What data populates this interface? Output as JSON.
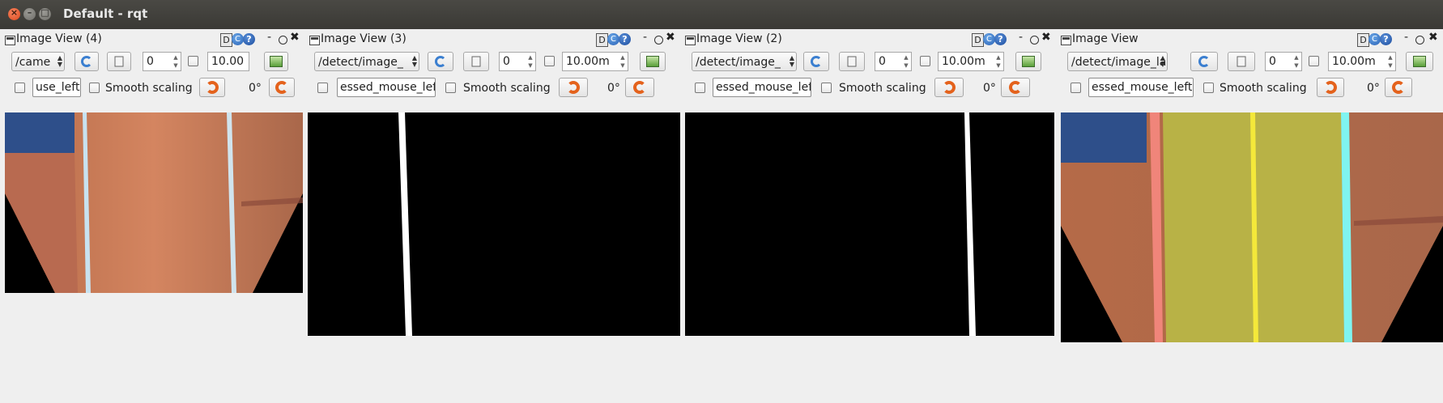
{
  "window": {
    "title": "Default - rqt",
    "close_glyph": "×",
    "min_glyph": "–",
    "max_glyph": "□"
  },
  "common": {
    "dock_glyph": "D",
    "refresh_glyph": "C",
    "help_glyph": "?",
    "dash_glyph": "-",
    "close_glyph": "✖",
    "smooth_label": "Smooth scaling",
    "rotation": "0°",
    "spin_up": "▲",
    "spin_down": "▼"
  },
  "panels": [
    {
      "title": "Image View (4)",
      "topic": "/came",
      "spin": "0",
      "zoom": "10.00",
      "mouse_topic": "use_left",
      "image": "camera_raw"
    },
    {
      "title": "Image View (3)",
      "topic": "/detect/image_",
      "spin": "0",
      "zoom": "10.00m",
      "mouse_topic": "essed_mouse_left",
      "image": "binary_left"
    },
    {
      "title": "Image View (2)",
      "topic": "/detect/image_",
      "spin": "0",
      "zoom": "10.00m",
      "mouse_topic": "essed_mouse_left",
      "image": "binary_right"
    },
    {
      "title": "Image View",
      "topic": "/detect/image_la",
      "spin": "0",
      "zoom": "10.00m",
      "mouse_topic": "essed_mouse_left",
      "image": "lane_overlay"
    }
  ],
  "colors": {
    "titlebar": "#3c3b37",
    "lane_yellow": "#f4e83a",
    "lane_cyan": "#7ff4f0",
    "lane_fill": "#b8b246"
  }
}
